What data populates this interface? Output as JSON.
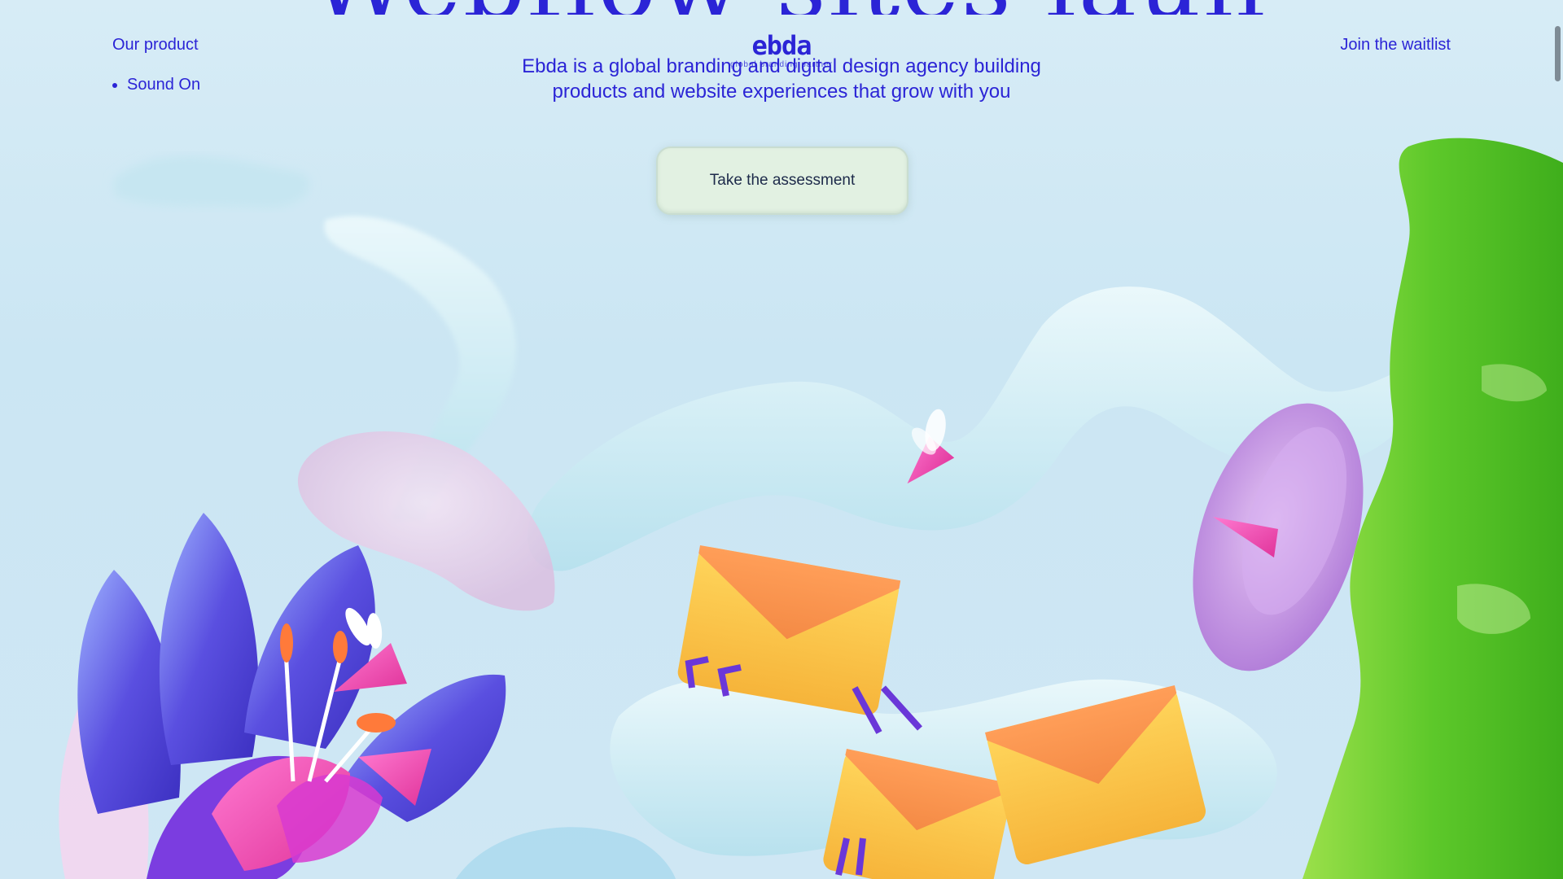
{
  "hero": {
    "headline": "Webflow sites launch"
  },
  "nav": {
    "our_product": "Our product",
    "sound": "Sound On",
    "waitlist": "Join the waitlist"
  },
  "logo": {
    "name": "ebda",
    "subtitle": "global branding partner"
  },
  "tagline": {
    "line1": "Ebda is a global branding and digital design agency building",
    "line2": "products and website experiences that grow with you"
  },
  "cta": {
    "label": "Take the assessment"
  },
  "colors": {
    "brand": "#2b24d6",
    "background": "#d7ecf6",
    "cta_bg": "#e2f1e2"
  },
  "icons": {
    "bullet": "disc-bullet",
    "envelope": "envelope-icon",
    "arrow": "cursor-arrow-icon"
  }
}
